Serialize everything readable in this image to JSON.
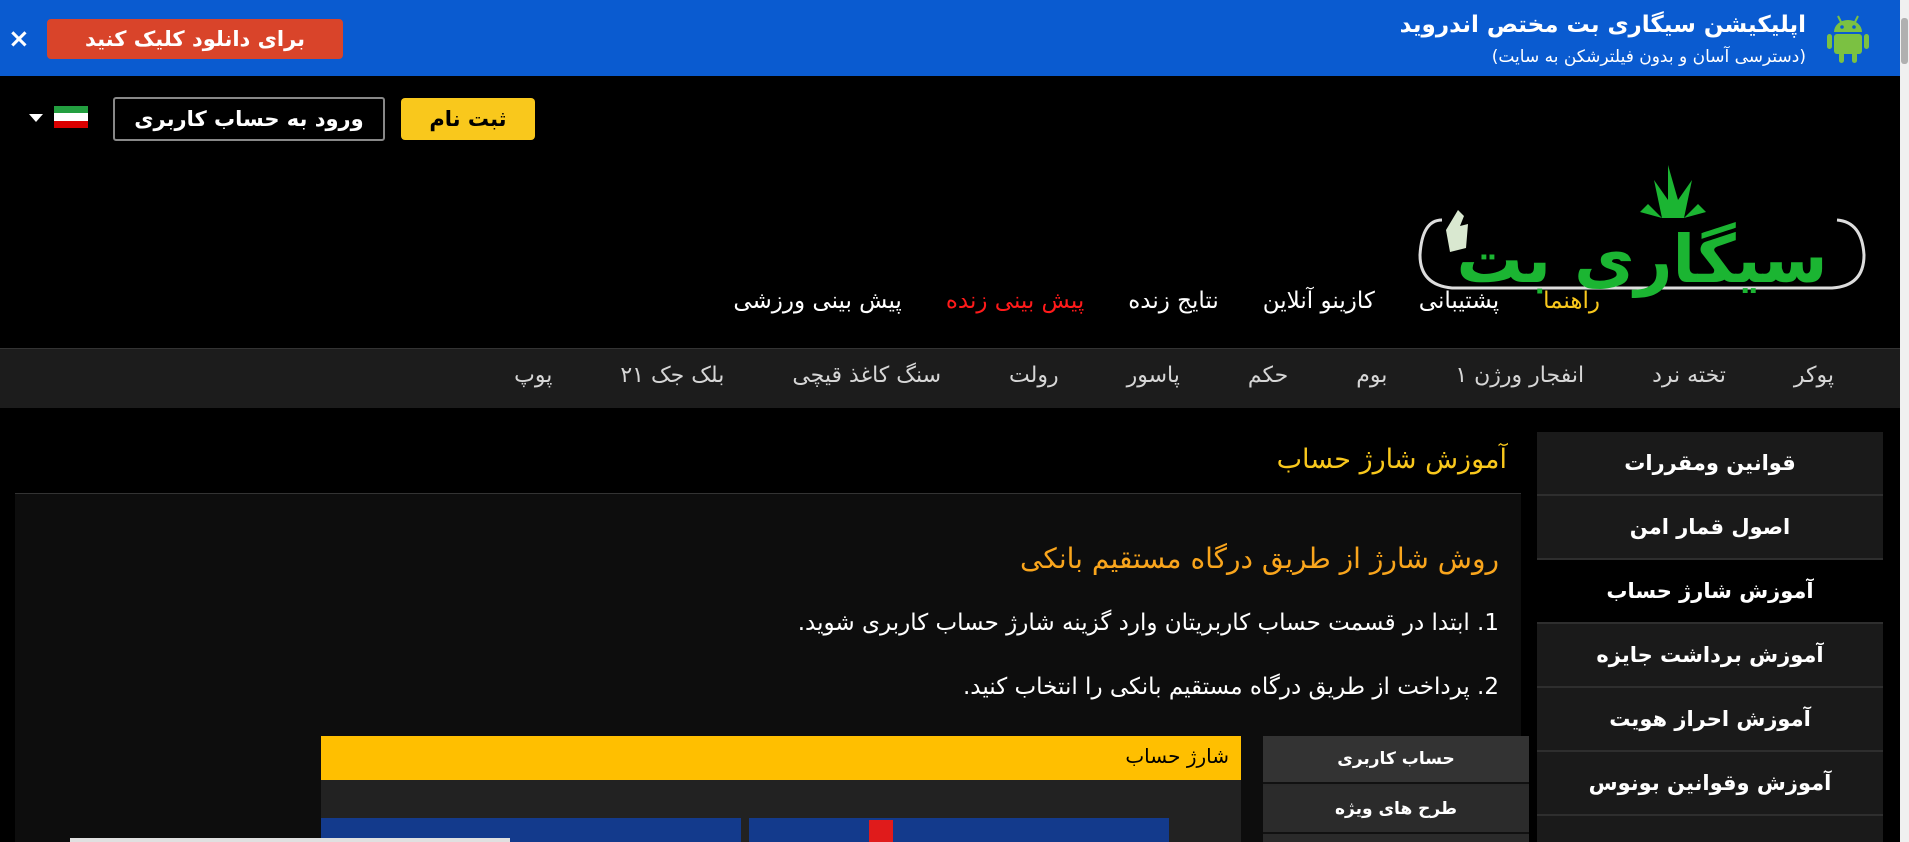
{
  "app_banner": {
    "title": "اپلیکیشن سیگاری بت مختص اندروید",
    "subtitle": "(دسترسی آسان و بدون فیلترشکن به سایت)",
    "download_button": "برای دانلود کلیک کنید",
    "close_symbol": "×",
    "icon": "android-icon",
    "background_color": "#0a5bd0",
    "button_color": "#d9442a"
  },
  "header": {
    "login_button": "ورود به حساب کاربری",
    "register_button": "ثبت نام",
    "language_flag": "iran-flag-icon",
    "logo": "سیگاری بت",
    "accent_color": "#f9c81c"
  },
  "main_nav": [
    {
      "label": "پیش بینی ورزشی",
      "style": "normal"
    },
    {
      "label": "پیش بینی زنده",
      "style": "red"
    },
    {
      "label": "نتایج زنده",
      "style": "normal"
    },
    {
      "label": "کازینو آنلاین",
      "style": "normal"
    },
    {
      "label": "پشتیبانی",
      "style": "normal"
    },
    {
      "label": "راهنما",
      "style": "gold"
    }
  ],
  "casino_nav": [
    "پوکر",
    "تخته نرد",
    "انفجار ورژن ۱",
    "بوم",
    "حکم",
    "پاسور",
    "رولت",
    "سنگ کاغذ قیچی",
    "بلک جک ۲۱",
    "پوپ"
  ],
  "sidebar": [
    {
      "label": "قوانین ومقررات",
      "active": false
    },
    {
      "label": "اصول قمار امن",
      "active": false
    },
    {
      "label": "آموزش شارژ حساب",
      "active": true
    },
    {
      "label": "آموزش برداشت جایزه",
      "active": false
    },
    {
      "label": "آموزش احراز هویت",
      "active": false
    },
    {
      "label": "آموزش وقوانین بونوس",
      "active": false
    }
  ],
  "content": {
    "title": "آموزش شارژ حساب",
    "section_heading": "روش شارژ از طریق درگاه مستقیم بانکی",
    "steps": [
      "1. ابتدا در قسمت حساب کاربریتان وارد گزینه شارژ حساب کاربری شوید.",
      "2. پرداخت از طریق درگاه مستقیم بانکی را انتخاب کنید."
    ],
    "screenshot": {
      "header": "شارژ حساب",
      "side_items": [
        "حساب کاربری",
        "طرح های ویژه"
      ]
    }
  }
}
